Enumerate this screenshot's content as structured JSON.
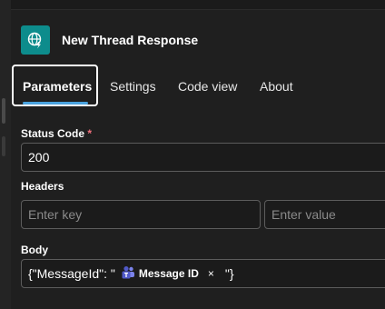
{
  "header": {
    "title": "New Thread Response",
    "icon": "globe-lightning-icon",
    "icon_color": "#0d8c8c"
  },
  "tabs": [
    {
      "label": "Parameters",
      "active": true
    },
    {
      "label": "Settings",
      "active": false
    },
    {
      "label": "Code view",
      "active": false
    },
    {
      "label": "About",
      "active": false
    }
  ],
  "status_code": {
    "label": "Status Code",
    "required_mark": "*",
    "value": "200"
  },
  "headers": {
    "label": "Headers",
    "key_placeholder": "Enter key",
    "value_placeholder": "Enter value"
  },
  "body": {
    "label": "Body",
    "prefix": "{\"MessageId\": \"",
    "token_label": "Message ID",
    "token_icon": "teams-icon",
    "token_remove": "×",
    "suffix": "\"}"
  },
  "colors": {
    "accent": "#4aa3df",
    "required": "#f1707b",
    "background": "#1f1f1f"
  }
}
